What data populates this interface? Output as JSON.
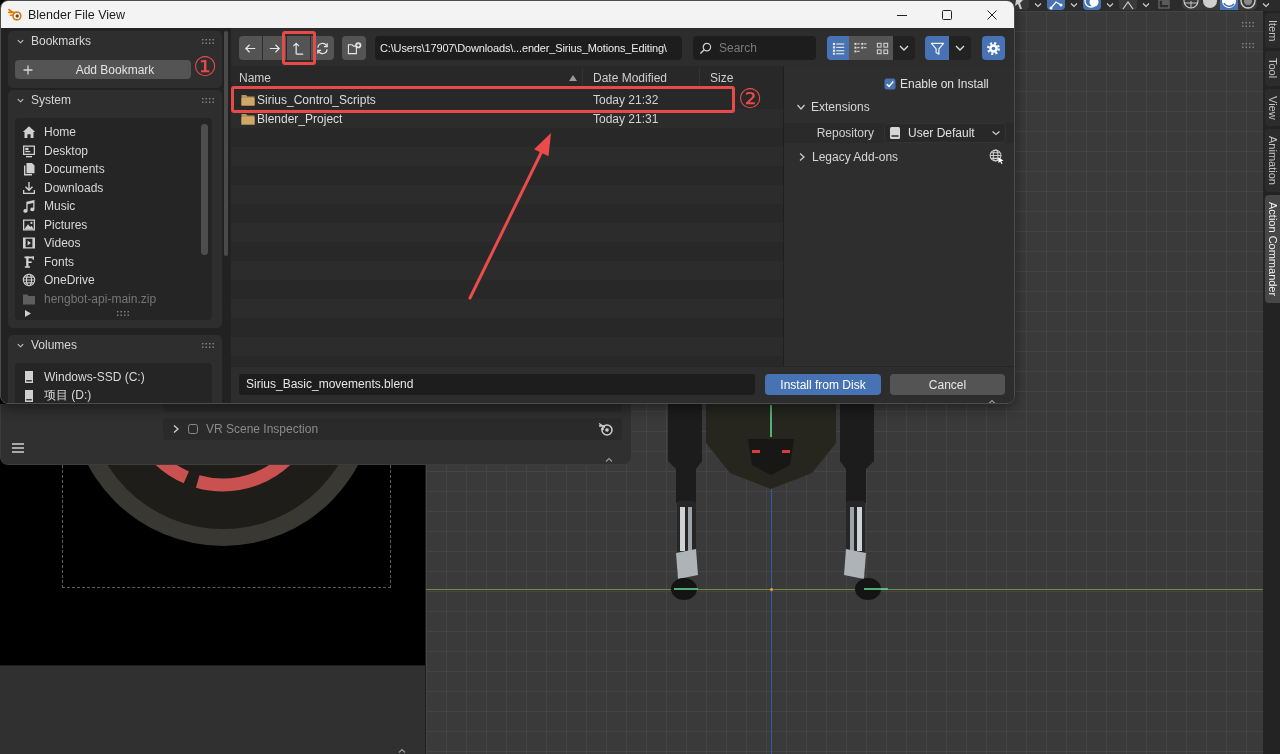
{
  "window": {
    "title": "Blender File View"
  },
  "sidebar": {
    "panels": [
      {
        "kind": "bookmarks",
        "title": "Bookmarks",
        "expanded": true,
        "button": "Add Bookmark"
      },
      {
        "kind": "system",
        "title": "System",
        "expanded": true,
        "items": [
          {
            "label": "Home",
            "kind": "home",
            "disabled": false
          },
          {
            "label": "Desktop",
            "kind": "desktop",
            "disabled": false
          },
          {
            "label": "Documents",
            "kind": "documents",
            "disabled": false
          },
          {
            "label": "Downloads",
            "kind": "downloads",
            "disabled": false
          },
          {
            "label": "Music",
            "kind": "music",
            "disabled": false
          },
          {
            "label": "Pictures",
            "kind": "pictures",
            "disabled": false
          },
          {
            "label": "Videos",
            "kind": "videos",
            "disabled": false
          },
          {
            "label": "Fonts",
            "kind": "fonts",
            "disabled": false
          },
          {
            "label": "OneDrive",
            "kind": "cloud",
            "disabled": false
          },
          {
            "label": "hengbot-api-main.zip",
            "kind": "folder",
            "disabled": true
          }
        ]
      },
      {
        "kind": "volumes",
        "title": "Volumes",
        "expanded": true,
        "items": [
          {
            "label": "Windows-SSD (C:)",
            "kind": "drive",
            "disabled": false
          },
          {
            "label": "项目 (D:)",
            "kind": "drive",
            "disabled": false
          }
        ]
      }
    ]
  },
  "toolbar": {
    "path": "C:\\Users\\17907\\Downloads\\...ender_Sirius_Motions_Editing\\",
    "search_placeholder": "Search",
    "display_modes": [
      {
        "kind": "vertical-list",
        "selected": true
      },
      {
        "kind": "horizontal-list",
        "selected": false
      },
      {
        "kind": "thumbnails",
        "selected": false
      }
    ],
    "filter": {
      "on": true
    },
    "settings": {
      "on": true
    }
  },
  "file_list": {
    "columns": [
      {
        "label": "Name",
        "sorted": true
      },
      {
        "label": "Date Modified",
        "sorted": false
      },
      {
        "label": "Size",
        "sorted": false
      }
    ],
    "rows": [
      {
        "name": "Sirius_Control_Scripts",
        "date_modified": "Today 21:32",
        "selected": false
      },
      {
        "name": "Blender_Project",
        "date_modified": "Today 21:31",
        "selected": false
      }
    ]
  },
  "options": {
    "enable_on_install": {
      "label": "Enable on Install",
      "checked": true
    },
    "sections": [
      {
        "kind": "extensions",
        "title": "Extensions",
        "expanded": true,
        "fields": [
          {
            "label": "Repository",
            "value": "User Default"
          }
        ]
      },
      {
        "kind": "legacy",
        "title": "Legacy Add-ons",
        "expanded": false
      }
    ]
  },
  "footer": {
    "filename": "Sirius_Basic_movements.blend",
    "buttons": [
      {
        "label": "Install from Disk",
        "kind": "primary"
      },
      {
        "label": "Cancel",
        "kind": "secondary"
      }
    ]
  },
  "annotations": [
    {
      "kind": "step",
      "number": "①"
    },
    {
      "kind": "step",
      "number": "②"
    }
  ],
  "preferences": {
    "addon": {
      "label": "VR Scene Inspection",
      "enabled": false,
      "expanded": false
    }
  },
  "viewport": {
    "header": {
      "toggles": [
        {
          "kind": "cursor",
          "on": false
        },
        {
          "kind": "gizmo",
          "on": true
        },
        {
          "kind": "overlay",
          "on": true
        },
        {
          "kind": "bones",
          "on": false
        },
        {
          "kind": "xray",
          "on": false
        }
      ],
      "shading_modes": [
        {
          "kind": "wireframe",
          "selected": false
        },
        {
          "kind": "solid",
          "selected": false
        },
        {
          "kind": "material",
          "selected": true
        },
        {
          "kind": "rendered",
          "selected": false
        }
      ]
    },
    "tabs": [
      {
        "label": "Item",
        "selected": false
      },
      {
        "label": "Tool",
        "selected": false
      },
      {
        "label": "View",
        "selected": false
      },
      {
        "label": "Animation",
        "selected": false
      },
      {
        "label": "Action Commander",
        "selected": true
      }
    ]
  }
}
